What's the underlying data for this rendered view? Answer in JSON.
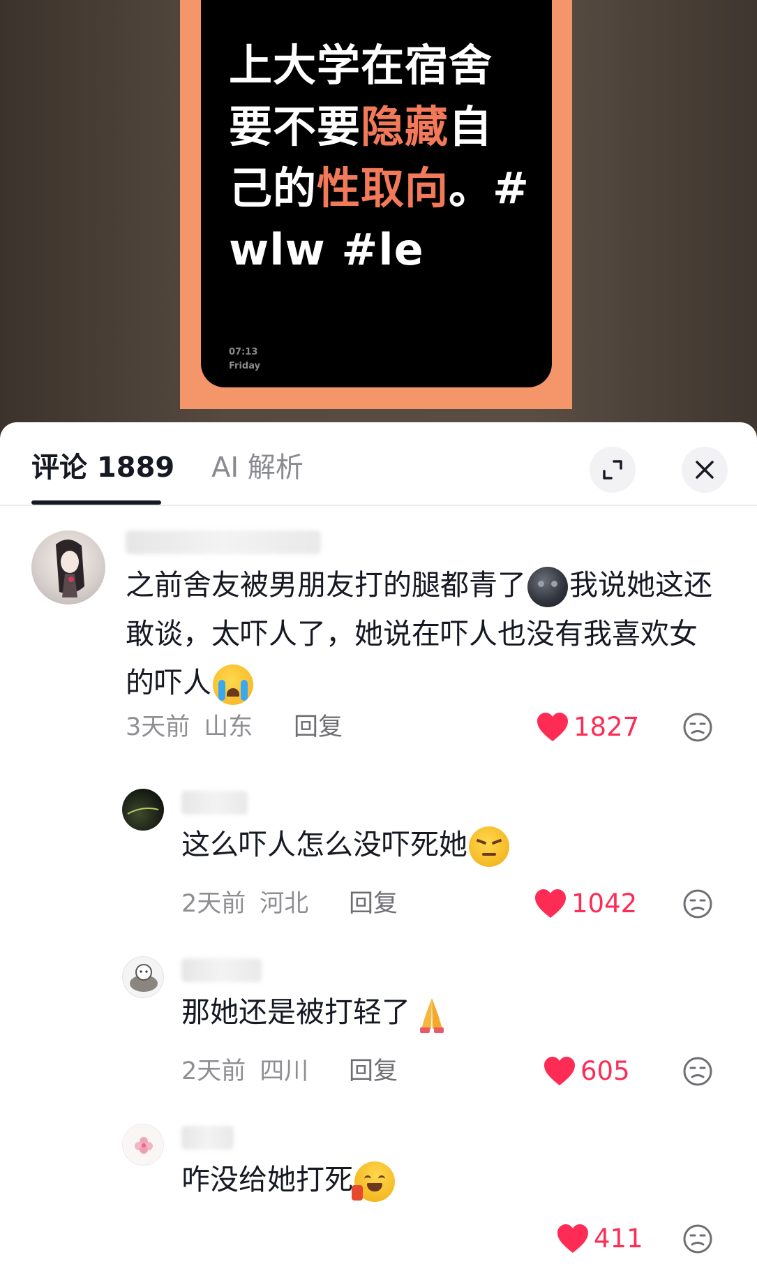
{
  "post": {
    "line1": "上大学在宿舍",
    "line2_a": "要不要",
    "line2_hl": "隐藏",
    "line2_b": "自",
    "line3_a": "己的",
    "line3_hl": "性取向",
    "line3_b": "。#",
    "line4": "wlw #le",
    "time": "07:13",
    "day": "Friday"
  },
  "sheet": {
    "tab_comments": "评论 1889",
    "tab_ai": "AI 解析"
  },
  "comments": [
    {
      "text_a": "之前舍友被男朋友打的腿都青了",
      "text_b": "我说她这还敢谈，太吓人了，她说在吓人也没有我喜欢女的吓人",
      "time": "3天前",
      "location": "山东",
      "reply": "回复",
      "likes": "1827",
      "emoji1": "dark-moon-face",
      "emoji2": "crying-face"
    },
    {
      "text": "这么吓人怎么没吓死她",
      "time": "2天前",
      "location": "河北",
      "reply": "回复",
      "likes": "1042",
      "emoji": "angry-face"
    },
    {
      "text": "那她还是被打轻了",
      "time": "2天前",
      "location": "四川",
      "reply": "回复",
      "likes": "605",
      "emoji": "praying-hands"
    },
    {
      "text": "咋没给她打死",
      "likes": "411",
      "emoji": "laughing-face"
    }
  ],
  "colors": {
    "accent": "#fe2c55",
    "highlight": "#f27a5a",
    "frame": "#f5956a"
  }
}
